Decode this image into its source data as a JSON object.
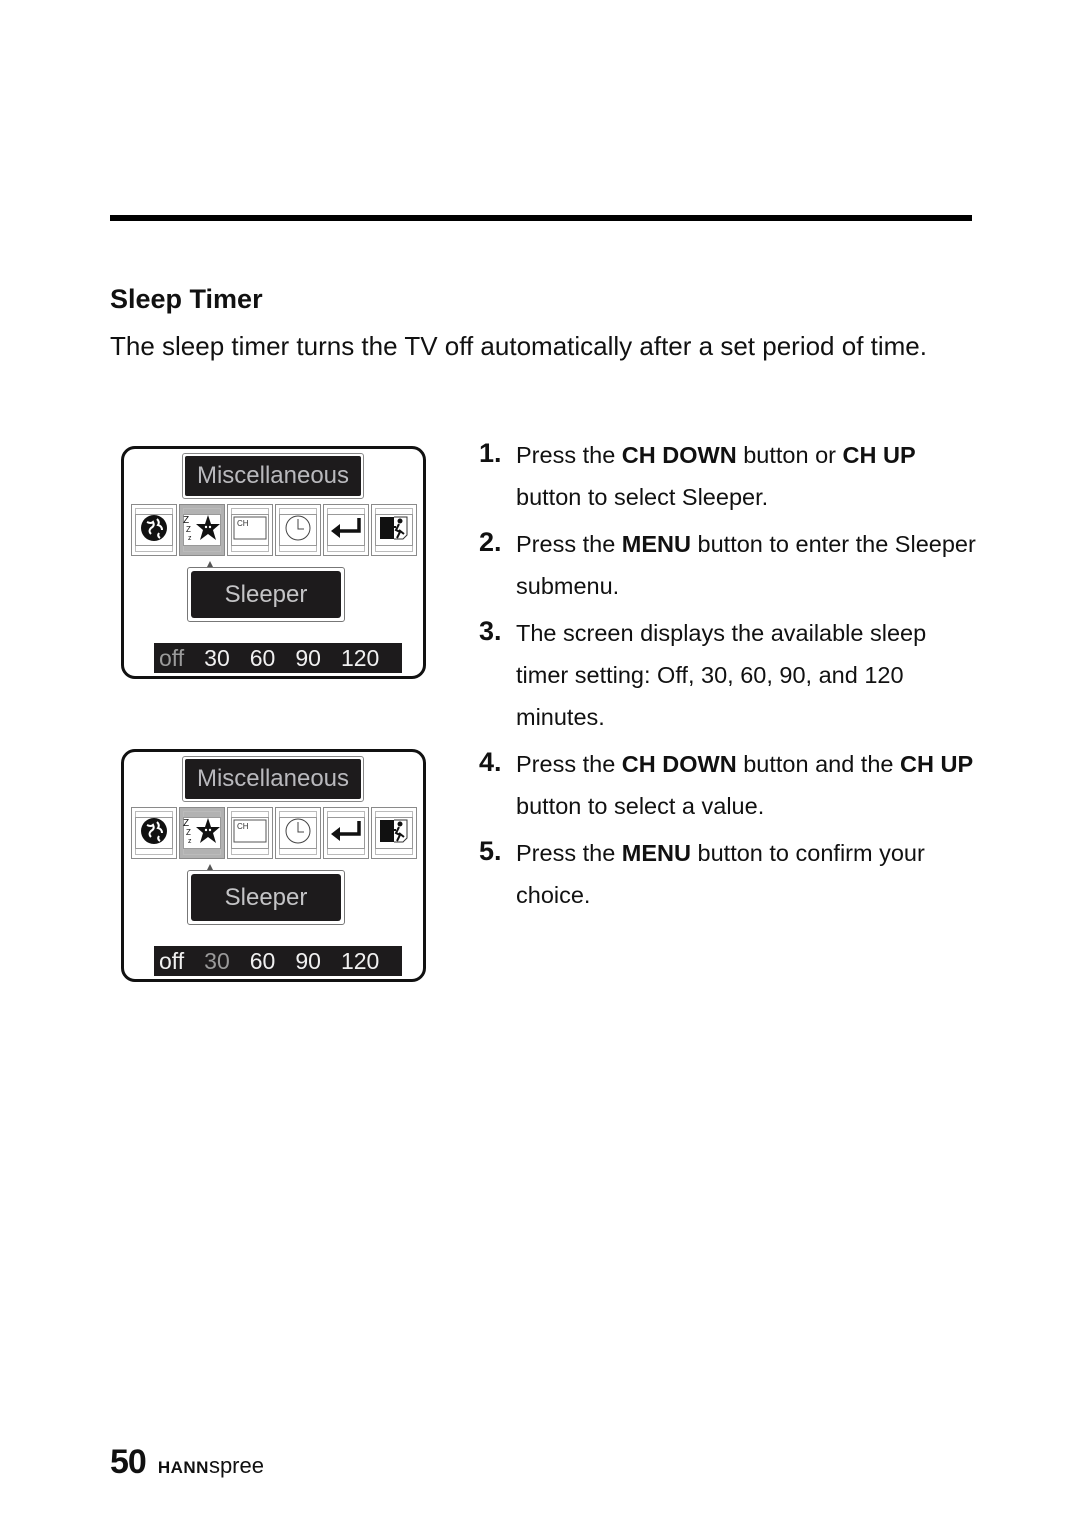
{
  "section": {
    "title": "Sleep Timer",
    "intro": "The sleep timer turns the TV off automatically after a set period of time."
  },
  "osd_screens": [
    {
      "menu_title": "Miscellaneous",
      "icons": [
        "globe-icon",
        "sleep-star-icon",
        "channel-icon",
        "clock-icon",
        "return-icon",
        "exit-icon"
      ],
      "selected_icon": "sleep-star-icon",
      "submenu_label": "Sleeper",
      "options": [
        "off",
        "30",
        "60",
        "90",
        "120"
      ],
      "highlighted_option": "off"
    },
    {
      "menu_title": "Miscellaneous",
      "icons": [
        "globe-icon",
        "sleep-star-icon",
        "channel-icon",
        "clock-icon",
        "return-icon",
        "exit-icon"
      ],
      "selected_icon": "sleep-star-icon",
      "submenu_label": "Sleeper",
      "options": [
        "off",
        "30",
        "60",
        "90",
        "120"
      ],
      "highlighted_option": "30"
    }
  ],
  "icon_labels": {
    "channel": "CH"
  },
  "steps": [
    {
      "num": "1.",
      "parts": [
        [
          "t",
          "Press the "
        ],
        [
          "b",
          "CH DOWN"
        ],
        [
          "t",
          " button or "
        ],
        [
          "b",
          "CH UP"
        ],
        [
          "t",
          " button to select Sleeper."
        ]
      ]
    },
    {
      "num": "2.",
      "parts": [
        [
          "t",
          "Press the "
        ],
        [
          "b",
          "MENU"
        ],
        [
          "t",
          " button to enter the Sleeper submenu."
        ]
      ]
    },
    {
      "num": "3.",
      "parts": [
        [
          "t",
          "The screen displays the available sleep timer setting: Off, 30, 60, 90, and 120 minutes."
        ]
      ]
    },
    {
      "num": "4.",
      "parts": [
        [
          "t",
          "Press the "
        ],
        [
          "b",
          "CH DOWN"
        ],
        [
          "t",
          " button and the "
        ],
        [
          "b",
          "CH UP"
        ],
        [
          "t",
          " button to select a value."
        ]
      ]
    },
    {
      "num": "5.",
      "parts": [
        [
          "t",
          "Press the "
        ],
        [
          "b",
          "MENU"
        ],
        [
          "t",
          " button to confirm your choice."
        ]
      ]
    }
  ],
  "footer": {
    "page_number": "50",
    "brand_bold": "HANN",
    "brand_light": "spree"
  }
}
